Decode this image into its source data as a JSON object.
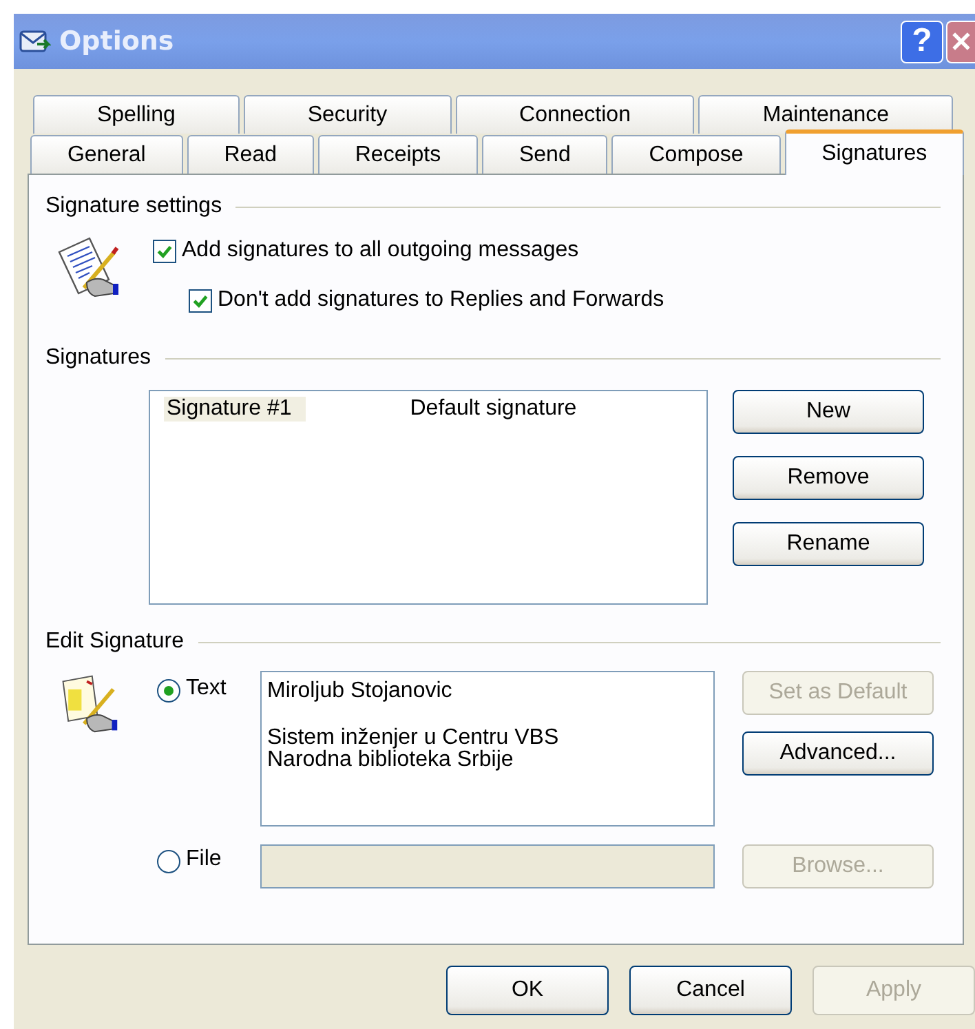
{
  "window": {
    "title": "Options",
    "help_button": "?"
  },
  "tab_rows": [
    [
      {
        "label": "Spelling",
        "selected": false
      },
      {
        "label": "Security",
        "selected": false
      },
      {
        "label": "Connection",
        "selected": false
      },
      {
        "label": "Maintenance",
        "selected": false
      }
    ],
    [
      {
        "label": "General",
        "selected": false
      },
      {
        "label": "Read",
        "selected": false
      },
      {
        "label": "Receipts",
        "selected": false
      },
      {
        "label": "Send",
        "selected": false
      },
      {
        "label": "Compose",
        "selected": false
      },
      {
        "label": "Signatures",
        "selected": true
      }
    ]
  ],
  "signature_settings": {
    "heading": "Signature settings",
    "options": [
      {
        "label": "Add signatures to all outgoing messages",
        "checked": true
      },
      {
        "label": "Don't add signatures to Replies and Forwards",
        "checked": true
      }
    ]
  },
  "signatures": {
    "heading": "Signatures",
    "rows": [
      {
        "name": "Signature #1",
        "description": "Default signature",
        "selected": true
      }
    ],
    "buttons": [
      {
        "label": "New",
        "disabled": false
      },
      {
        "label": "Remove",
        "disabled": false
      },
      {
        "label": "Rename",
        "disabled": false
      }
    ]
  },
  "edit_signature": {
    "heading": "Edit Signature",
    "text_option": {
      "label": "Text",
      "selected": true
    },
    "text_value": "Miroljub Stojanovic\n\nSistem inženjer u Centru VBS\nNarodna biblioteka Srbije",
    "file_option": {
      "label": "File",
      "selected": false
    },
    "text_buttons": [
      {
        "label": "Set as Default",
        "disabled": true
      },
      {
        "label": "Advanced...",
        "disabled": false
      }
    ],
    "file_button": {
      "label": "Browse...",
      "disabled": true
    }
  },
  "footer_buttons": [
    {
      "label": "OK",
      "disabled": false
    },
    {
      "label": "Cancel",
      "disabled": false
    },
    {
      "label": "Apply",
      "disabled": true
    }
  ]
}
